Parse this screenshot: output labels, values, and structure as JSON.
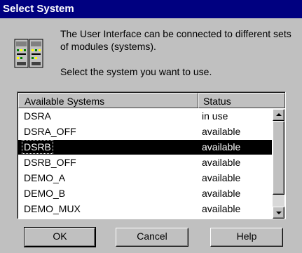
{
  "window": {
    "title": "Select System"
  },
  "description": {
    "line1": "The User Interface can be connected to different sets of modules (systems).",
    "line2": "Select the system you want to use."
  },
  "list": {
    "columns": [
      "Available Systems",
      "Status"
    ],
    "rows": [
      {
        "name": "DSRA",
        "status": "in use"
      },
      {
        "name": "DSRA_OFF",
        "status": "available"
      },
      {
        "name": "DSRB",
        "status": "available"
      },
      {
        "name": "DSRB_OFF",
        "status": "available"
      },
      {
        "name": "DEMO_A",
        "status": "available"
      },
      {
        "name": "DEMO_B",
        "status": "available"
      },
      {
        "name": "DEMO_MUX",
        "status": "available"
      }
    ],
    "selected_row": 2,
    "icons": {
      "scroll_up": "scroll-up-arrow-icon",
      "scroll_down": "scroll-down-arrow-icon"
    }
  },
  "buttons": {
    "ok": "OK",
    "cancel": "Cancel",
    "help": "Help"
  },
  "icons": {
    "app": "system-modules-icon"
  },
  "colors": {
    "title_bar": "#000080",
    "dialog_bg": "#c0c0c0",
    "selection": "#000000"
  }
}
